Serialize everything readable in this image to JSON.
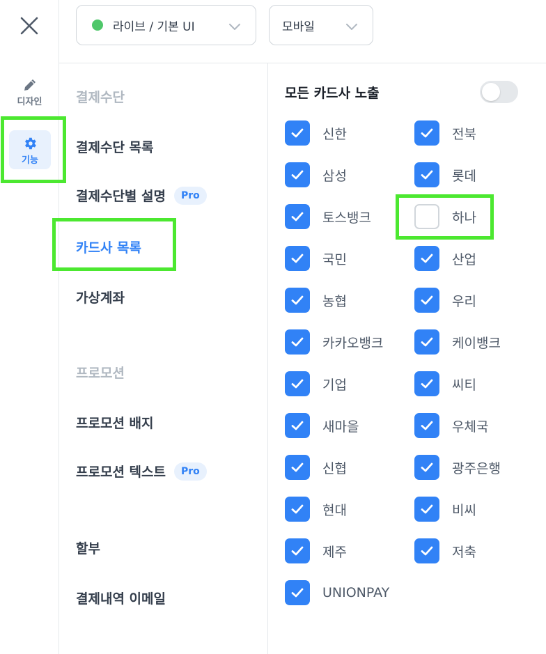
{
  "rail": {
    "close_icon": "close-icon",
    "design_label": "디자인",
    "design_icon": "pencil-icon",
    "function_label": "기능",
    "function_icon": "gear-icon"
  },
  "topbar": {
    "env_select": {
      "value": "라이브 / 기본 UI",
      "status_color": "#4fc76a"
    },
    "device_select": {
      "value": "모바일"
    }
  },
  "menu": {
    "payment_section": "결제수단",
    "payment_list": "결제수단 목록",
    "payment_desc": "결제수단별 설명",
    "payment_desc_badge": "Pro",
    "card_list": "카드사 목록",
    "virtual_account": "가상계좌",
    "promo_section": "프로모션",
    "promo_badge_item": "프로모션 배지",
    "promo_text_item": "프로모션 텍스트",
    "promo_text_badge": "Pro",
    "installment": "할부",
    "receipt_email": "결제내역 이메일"
  },
  "panel": {
    "show_all_label": "모든 카드사 노출",
    "show_all_enabled": false,
    "cards": [
      {
        "label": "신한",
        "checked": true
      },
      {
        "label": "전북",
        "checked": true
      },
      {
        "label": "삼성",
        "checked": true
      },
      {
        "label": "롯데",
        "checked": true
      },
      {
        "label": "토스뱅크",
        "checked": true
      },
      {
        "label": "하나",
        "checked": false
      },
      {
        "label": "국민",
        "checked": true
      },
      {
        "label": "산업",
        "checked": true
      },
      {
        "label": "농협",
        "checked": true
      },
      {
        "label": "우리",
        "checked": true
      },
      {
        "label": "카카오뱅크",
        "checked": true
      },
      {
        "label": "케이뱅크",
        "checked": true
      },
      {
        "label": "기업",
        "checked": true
      },
      {
        "label": "씨티",
        "checked": true
      },
      {
        "label": "새마을",
        "checked": true
      },
      {
        "label": "우체국",
        "checked": true
      },
      {
        "label": "신협",
        "checked": true
      },
      {
        "label": "광주은행",
        "checked": true
      },
      {
        "label": "현대",
        "checked": true
      },
      {
        "label": "비씨",
        "checked": true
      },
      {
        "label": "제주",
        "checked": true
      },
      {
        "label": "저축",
        "checked": true
      },
      {
        "label": "UNIONPAY",
        "checked": true
      }
    ]
  },
  "colors": {
    "accent": "#3182f6",
    "highlight": "#4ce830",
    "muted": "#b0b8c1"
  }
}
